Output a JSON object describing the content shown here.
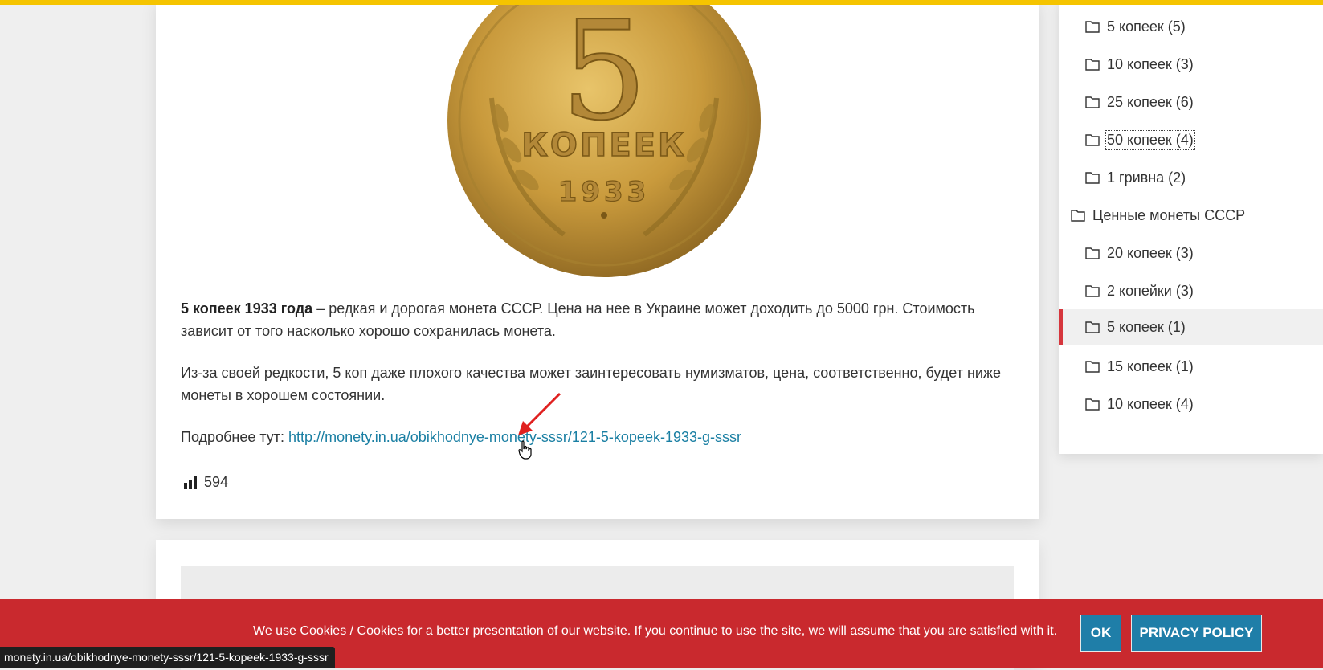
{
  "article": {
    "coin": {
      "denomination": "5",
      "word": "КОПЕЕК",
      "year": "1933"
    },
    "intro_bold": "5 копеек 1933 года",
    "intro_rest": " – редкая и дорогая монета СССР. Цена на нее в Украине может доходить до 5000 грн. Стоимость зависит от того насколько хорошо сохранилась монета.",
    "paragraph2": "Из-за своей редкости, 5 коп даже плохого качества может заинтересовать нумизматов, цена, соответственно, будет ниже монеты в хорошем состоянии.",
    "more_label": "Подробнее тут: ",
    "more_link": "http://monety.in.ua/obikhodnye-monety-sssr/121-5-kopeek-1933-g-sssr",
    "views": "594"
  },
  "sidebar": {
    "items": [
      {
        "label": "5 копеек (5)",
        "indent": 2
      },
      {
        "label": "10 копеек (3)",
        "indent": 2
      },
      {
        "label": "25 копеек (6)",
        "indent": 2
      },
      {
        "label": "50 копеек (4)",
        "indent": 2,
        "focused": true
      },
      {
        "label": "1 гривна (2)",
        "indent": 2
      },
      {
        "label": "Ценные монеты СССР",
        "indent": 1
      },
      {
        "label": "20 копеек (3)",
        "indent": 2
      },
      {
        "label": "2 копейки (3)",
        "indent": 2
      },
      {
        "label": "5 копеек (1)",
        "indent": 2,
        "active": true
      },
      {
        "label": "15 копеек (1)",
        "indent": 2
      },
      {
        "label": "10 копеек (4)",
        "indent": 2
      }
    ]
  },
  "cookie": {
    "text": "We use Cookies / Cookies for a better presentation of our website. If you continue to use the site, we will assume that you are satisfied with it.",
    "ok_label": "OK",
    "privacy_label": "PRIVACY POLICY"
  },
  "status_url": "monety.in.ua/obikhodnye-monety-sssr/121-5-kopeek-1933-g-sssr",
  "colors": {
    "accent_yellow": "#f5c400",
    "cookie_red": "#c9292e",
    "button_blue": "#1f7ea8",
    "link_blue": "#1a7fa3",
    "active_bar": "#d6363d"
  }
}
